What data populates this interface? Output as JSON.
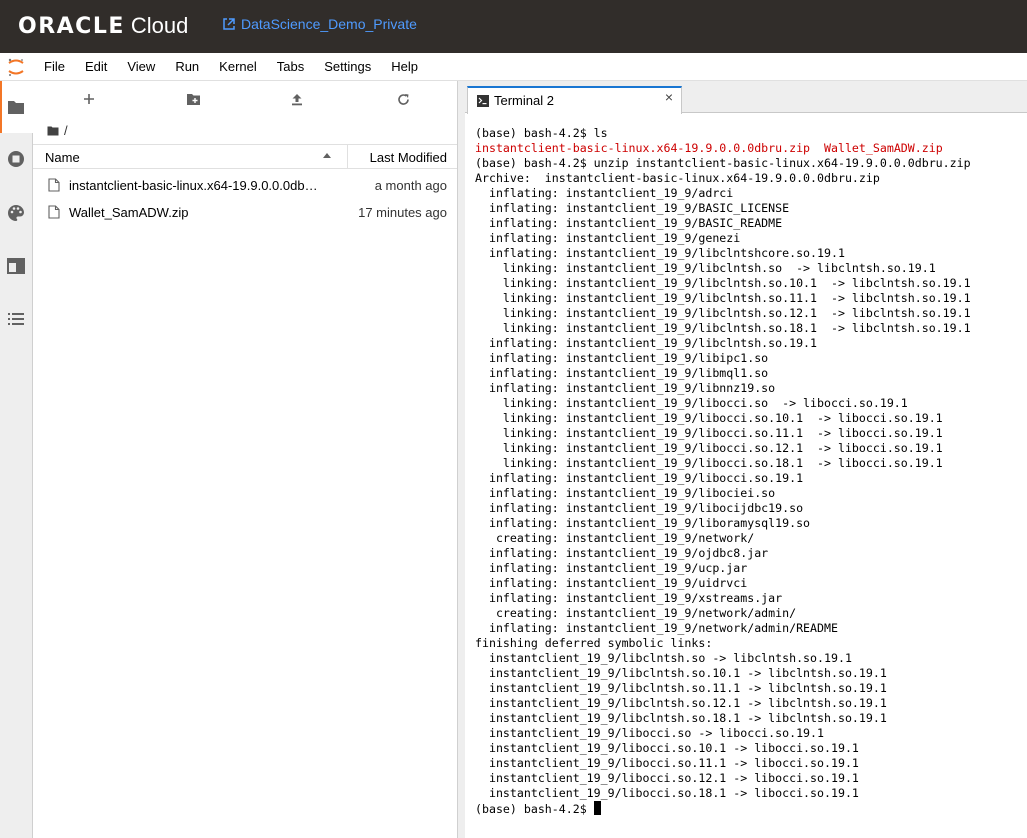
{
  "header": {
    "logo_oracle": "ORACLE",
    "logo_cloud": "Cloud",
    "project_name": "DataScience_Demo_Private"
  },
  "menu": [
    "File",
    "Edit",
    "View",
    "Run",
    "Kernel",
    "Tabs",
    "Settings",
    "Help"
  ],
  "file_browser": {
    "breadcrumb": "/",
    "columns": {
      "name": "Name",
      "modified": "Last Modified"
    },
    "files": [
      {
        "name": "instantclient-basic-linux.x64-19.9.0.0.0dbru.zip",
        "modified": "a month ago"
      },
      {
        "name": "Wallet_SamADW.zip",
        "modified": "17 minutes ago"
      }
    ]
  },
  "tab": {
    "label": "Terminal 2",
    "close": "×"
  },
  "terminal": {
    "lines": [
      "(base) bash-4.2$ ls",
      "",
      "(base) bash-4.2$ unzip instantclient-basic-linux.x64-19.9.0.0.0dbru.zip",
      "Archive:  instantclient-basic-linux.x64-19.9.0.0.0dbru.zip",
      "  inflating: instantclient_19_9/adrci",
      "  inflating: instantclient_19_9/BASIC_LICENSE",
      "  inflating: instantclient_19_9/BASIC_README",
      "  inflating: instantclient_19_9/genezi",
      "  inflating: instantclient_19_9/libclntshcore.so.19.1",
      "    linking: instantclient_19_9/libclntsh.so  -> libclntsh.so.19.1",
      "    linking: instantclient_19_9/libclntsh.so.10.1  -> libclntsh.so.19.1",
      "    linking: instantclient_19_9/libclntsh.so.11.1  -> libclntsh.so.19.1",
      "    linking: instantclient_19_9/libclntsh.so.12.1  -> libclntsh.so.19.1",
      "    linking: instantclient_19_9/libclntsh.so.18.1  -> libclntsh.so.19.1",
      "  inflating: instantclient_19_9/libclntsh.so.19.1",
      "  inflating: instantclient_19_9/libipc1.so",
      "  inflating: instantclient_19_9/libmql1.so",
      "  inflating: instantclient_19_9/libnnz19.so",
      "    linking: instantclient_19_9/libocci.so  -> libocci.so.19.1",
      "    linking: instantclient_19_9/libocci.so.10.1  -> libocci.so.19.1",
      "    linking: instantclient_19_9/libocci.so.11.1  -> libocci.so.19.1",
      "    linking: instantclient_19_9/libocci.so.12.1  -> libocci.so.19.1",
      "    linking: instantclient_19_9/libocci.so.18.1  -> libocci.so.19.1",
      "  inflating: instantclient_19_9/libocci.so.19.1",
      "  inflating: instantclient_19_9/libociei.so",
      "  inflating: instantclient_19_9/libocijdbc19.so",
      "  inflating: instantclient_19_9/liboramysql19.so",
      "   creating: instantclient_19_9/network/",
      "  inflating: instantclient_19_9/ojdbc8.jar",
      "  inflating: instantclient_19_9/ucp.jar",
      "  inflating: instantclient_19_9/uidrvci",
      "  inflating: instantclient_19_9/xstreams.jar",
      "   creating: instantclient_19_9/network/admin/",
      "  inflating: instantclient_19_9/network/admin/README",
      "finishing deferred symbolic links:",
      "  instantclient_19_9/libclntsh.so -> libclntsh.so.19.1",
      "  instantclient_19_9/libclntsh.so.10.1 -> libclntsh.so.19.1",
      "  instantclient_19_9/libclntsh.so.11.1 -> libclntsh.so.19.1",
      "  instantclient_19_9/libclntsh.so.12.1 -> libclntsh.so.19.1",
      "  instantclient_19_9/libclntsh.so.18.1 -> libclntsh.so.19.1",
      "  instantclient_19_9/libocci.so -> libocci.so.19.1",
      "  instantclient_19_9/libocci.so.10.1 -> libocci.so.19.1",
      "  instantclient_19_9/libocci.so.11.1 -> libocci.so.19.1",
      "  instantclient_19_9/libocci.so.12.1 -> libocci.so.19.1",
      "  instantclient_19_9/libocci.so.18.1 -> libocci.so.19.1"
    ],
    "ls_output": [
      "instantclient-basic-linux.x64-19.9.0.0.0dbru.zip",
      "  ",
      "Wallet_SamADW.zip"
    ],
    "prompt": "(base) bash-4.2$ "
  },
  "colors": {
    "topbar": "#312d2a",
    "link": "#4f9bff",
    "accent_tab": "#1976d2",
    "jupyter_orange": "#f37626",
    "terminal_red": "#cd0000"
  },
  "icons": {
    "sidebar": [
      "folder-icon",
      "running-icon",
      "palette-icon",
      "tabs-icon",
      "toc-icon"
    ],
    "toolbar": [
      "new-launcher-icon",
      "new-folder-icon",
      "upload-icon",
      "refresh-icon"
    ]
  }
}
